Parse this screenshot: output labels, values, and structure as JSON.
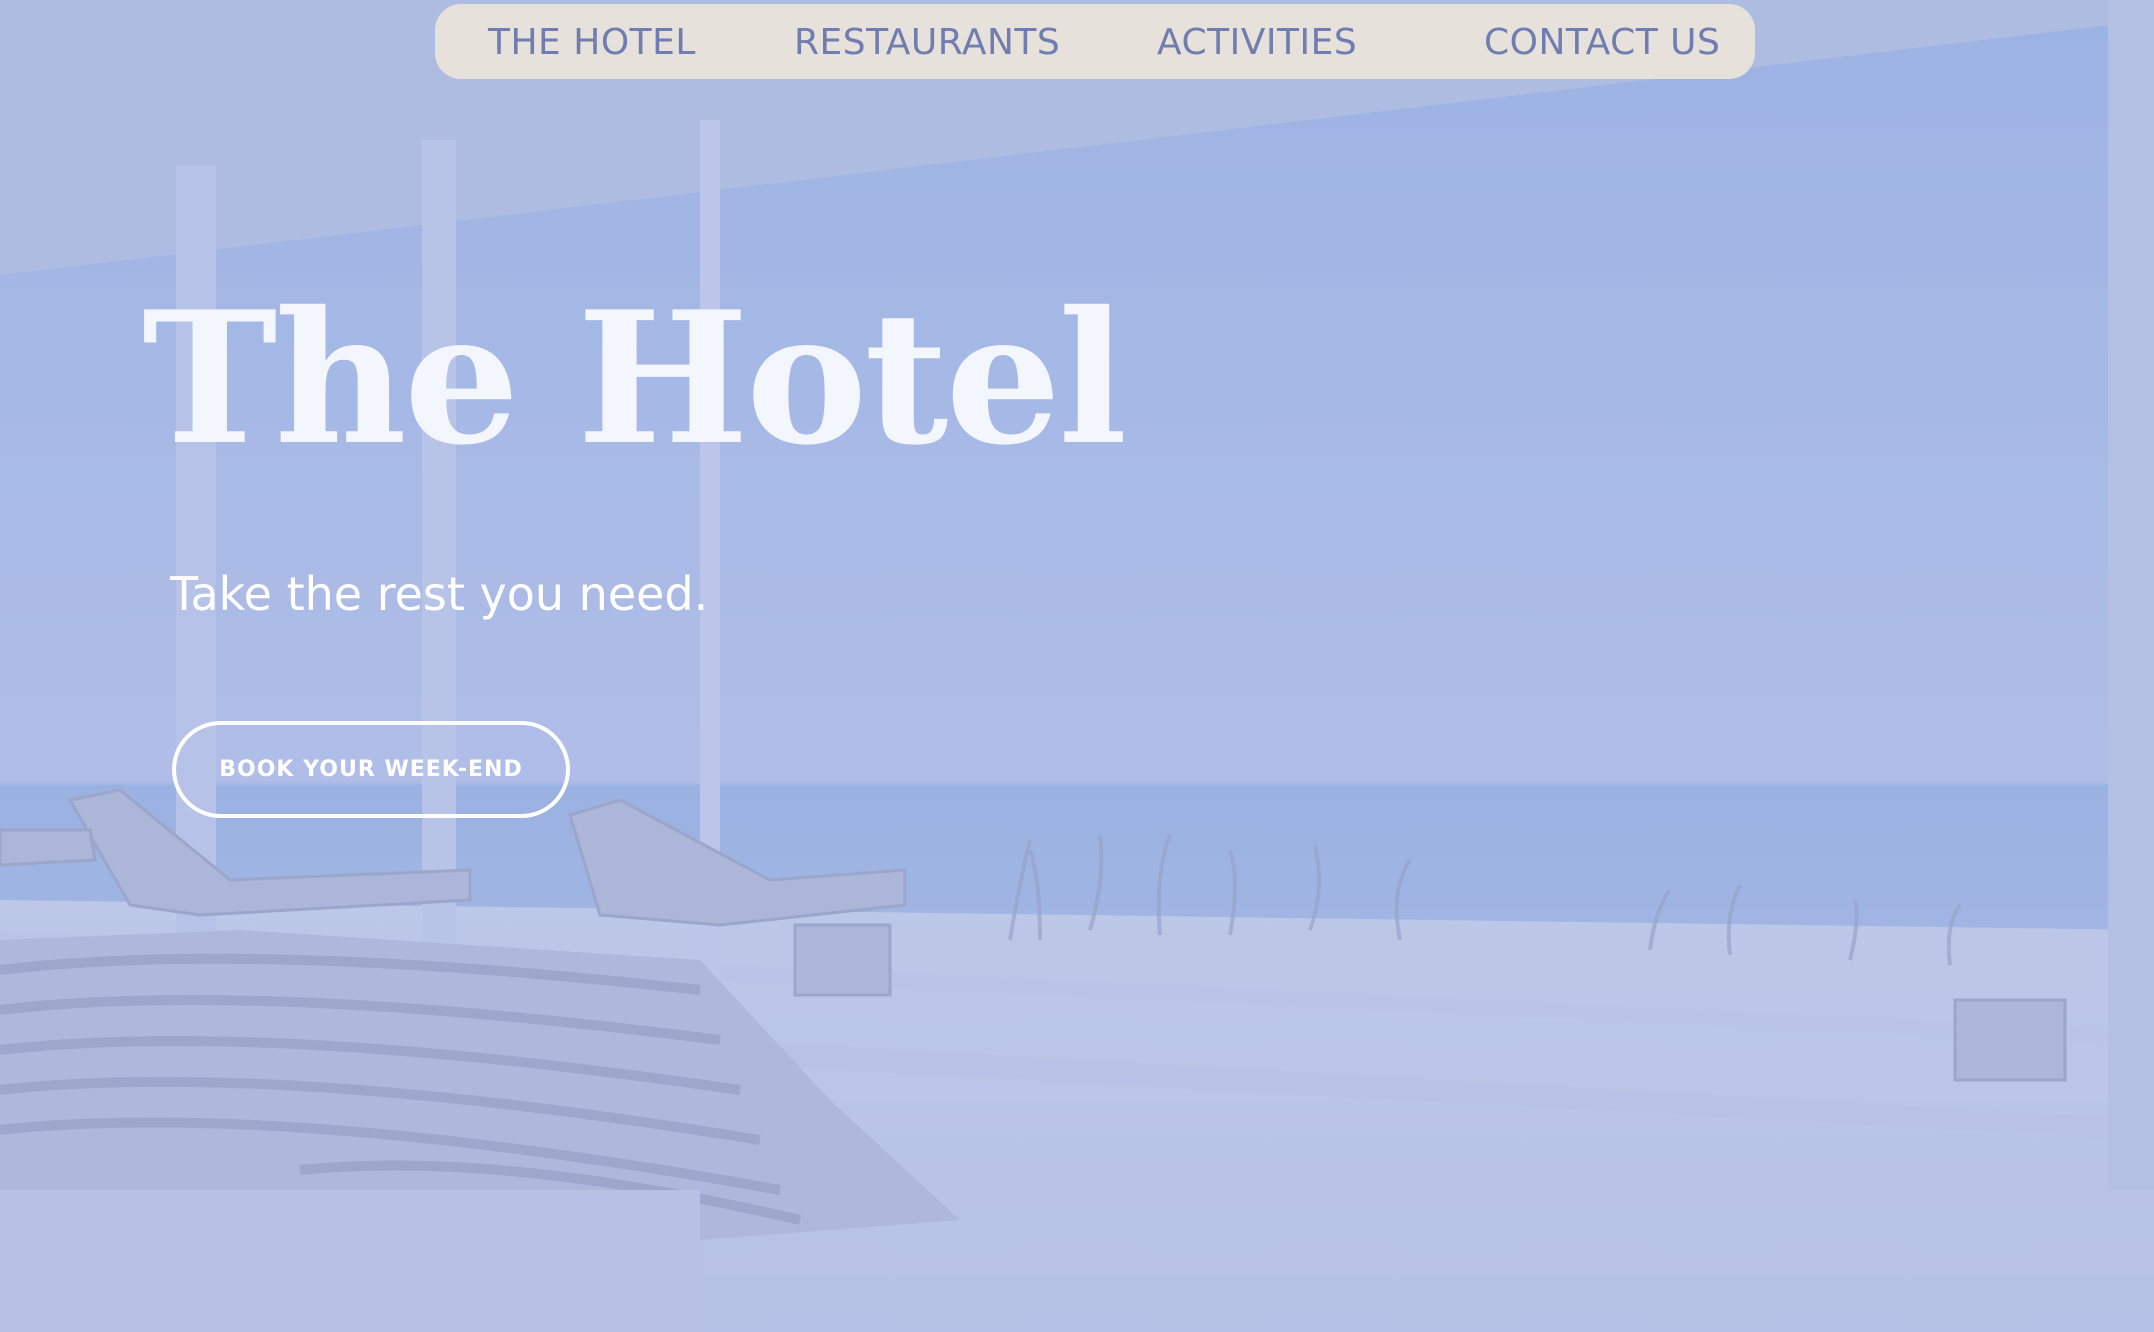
{
  "nav": {
    "items": [
      {
        "label": "THE HOTEL"
      },
      {
        "label": "RESTAURANTS"
      },
      {
        "label": "ACTIVITIES"
      },
      {
        "label": "CONTACT US"
      }
    ]
  },
  "hero": {
    "title": "The Hotel",
    "subtitle": "Take the rest you need.",
    "cta_label": "BOOK YOUR WEEK-END"
  },
  "colors": {
    "nav_background": "#e6e2db",
    "nav_text": "#6f7db0",
    "hero_text": "#ffffff",
    "overlay_tint": "#a9b8e0"
  }
}
